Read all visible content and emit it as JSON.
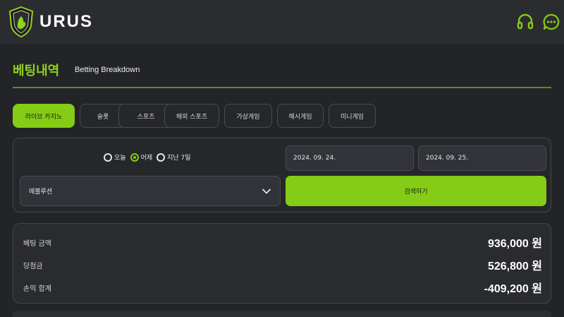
{
  "header": {
    "brand": "URUS",
    "icons": [
      "shield-logo-icon",
      "headset-icon",
      "chat-bubble-icon"
    ]
  },
  "page": {
    "title": "베팅내역",
    "subtitle": "Betting Breakdown"
  },
  "tabs": [
    {
      "label": "라이브 카지노",
      "active": true
    },
    {
      "label": "슬롯",
      "active": false
    },
    {
      "label": "스포츠",
      "active": false
    },
    {
      "label": "해외 스포츠",
      "active": false
    },
    {
      "label": "가상게임",
      "active": false
    },
    {
      "label": "해시게임",
      "active": false
    },
    {
      "label": "미니게임",
      "active": false
    }
  ],
  "filters": {
    "date_options": [
      {
        "label": "오늘",
        "checked": false
      },
      {
        "label": "어제",
        "checked": true
      },
      {
        "label": "지난 7일",
        "checked": false
      }
    ],
    "date_from": "2024. 09. 24.",
    "date_to": "2024. 09. 25.",
    "select_value": "에볼루션",
    "search_label": "검색하기"
  },
  "summary": [
    {
      "label": "베팅 금액",
      "value": "936,000 원"
    },
    {
      "label": "당첨금",
      "value": "526,800 원"
    },
    {
      "label": "손익 합계",
      "value": "-409,200 원"
    }
  ],
  "colors": {
    "accent": "#84cc16",
    "background": "#232427",
    "header": "#2b2c30"
  }
}
